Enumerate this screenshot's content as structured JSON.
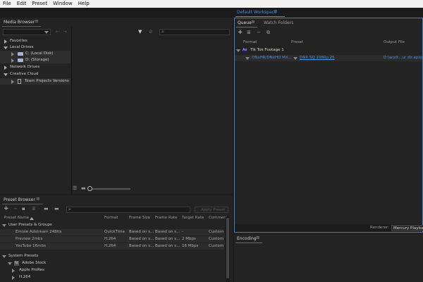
{
  "menu": [
    "File",
    "Edit",
    "Preset",
    "Window",
    "Help"
  ],
  "workspace": {
    "name": "Default Workspace"
  },
  "media_browser": {
    "title": "Media Browser",
    "tree": [
      {
        "label": "Favorites",
        "level": 0,
        "expanded": false
      },
      {
        "label": "Local Drives",
        "level": 0,
        "expanded": true
      },
      {
        "label": "C: (Local Disk)",
        "level": 1,
        "icon": "drive-icon"
      },
      {
        "label": "D: (Storage)",
        "level": 1,
        "icon": "drive-icon"
      },
      {
        "label": "Network Drives",
        "level": 0,
        "expanded": false
      },
      {
        "label": "Creative Cloud",
        "level": 0,
        "expanded": true
      },
      {
        "label": "Team Projects Versions",
        "level": 1,
        "icon": "document-icon"
      }
    ]
  },
  "queue": {
    "tabs": [
      {
        "label": "Queue",
        "active": true
      },
      {
        "label": "Watch Folders",
        "active": false
      }
    ],
    "columns": {
      "format": "Format",
      "preset": "Preset",
      "output": "Output File"
    },
    "item": {
      "badge": "Ae",
      "name": "Tik Tok Footage 1"
    },
    "output_row": {
      "format": "DNxHR/DNxHD MX...",
      "preset": "DNX SQ 1080p 25",
      "output": "D:\\work...ur dir.episo"
    },
    "renderer_label": "Renderer:",
    "renderer_value": "Mercury Playback"
  },
  "encoding": {
    "title": "Encoding"
  },
  "preset_browser": {
    "title": "Preset Browser",
    "apply_label": "Apply Preset",
    "columns": [
      "Preset Name",
      "Format",
      "Frame Size",
      "Frame Rate",
      "Target Rate",
      "Comment"
    ],
    "groups": [
      {
        "name": "User Presets & Groups",
        "rows": [
          [
            "Emisie Adstream 24Bits",
            "QuickTime",
            "Based on s...",
            "Based on s...",
            "-",
            "Custom"
          ],
          [
            "Preview 2mbs",
            "H.264",
            "Based on s...",
            "Based on s...",
            "2 Mbps",
            "Custom"
          ],
          [
            "YouTube 16mbs",
            "H.264",
            "Based on s...",
            "Based on s...",
            "16 Mbps",
            "Custom"
          ]
        ]
      }
    ],
    "system": {
      "label": "System Presets",
      "items": [
        {
          "label": "Adobe Stock",
          "badge": "St"
        },
        {
          "label": "Apple ProRes"
        },
        {
          "label": "H.264"
        }
      ]
    }
  }
}
